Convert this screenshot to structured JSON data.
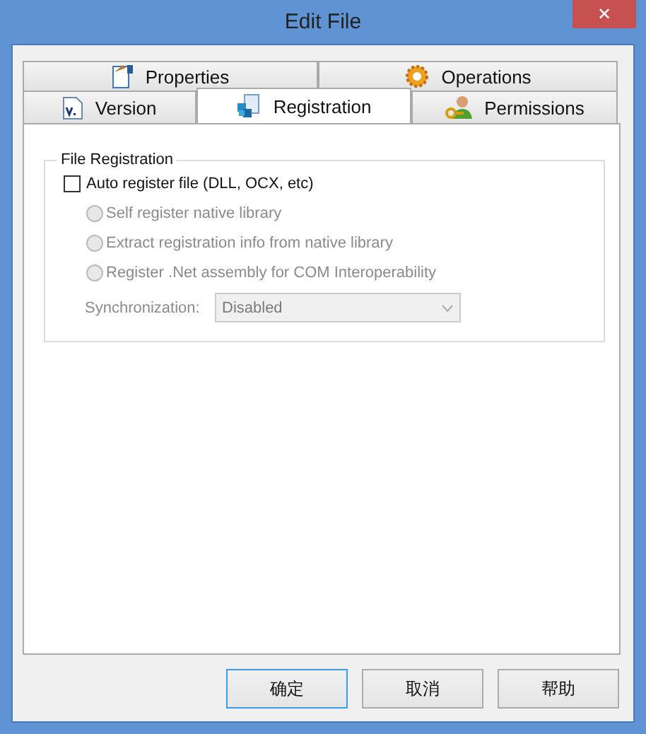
{
  "window": {
    "title": "Edit File",
    "close": "✕"
  },
  "tab_rows": [
    [
      {
        "label": "Properties",
        "selected": false
      },
      {
        "label": "Operations",
        "selected": false
      }
    ],
    [
      {
        "label": "Version",
        "selected": false
      },
      {
        "label": "Registration",
        "selected": true
      },
      {
        "label": "Permissions",
        "selected": false
      }
    ]
  ],
  "group": {
    "title": "File Registration",
    "checkbox": {
      "label": "Auto register file (DLL, OCX, etc)",
      "checked": false
    },
    "radios": [
      {
        "label": "Self register native library",
        "selected": false,
        "disabled": true
      },
      {
        "label": "Extract registration info from native library",
        "selected": false,
        "disabled": true
      },
      {
        "label": "Register .Net assembly for COM Interoperability",
        "selected": false,
        "disabled": true
      }
    ],
    "sync": {
      "label": "Synchronization:",
      "value": "Disabled",
      "disabled": true
    }
  },
  "buttons": [
    {
      "label": "确定",
      "default": true
    },
    {
      "label": "取消",
      "default": false
    },
    {
      "label": "帮助",
      "default": false
    }
  ]
}
